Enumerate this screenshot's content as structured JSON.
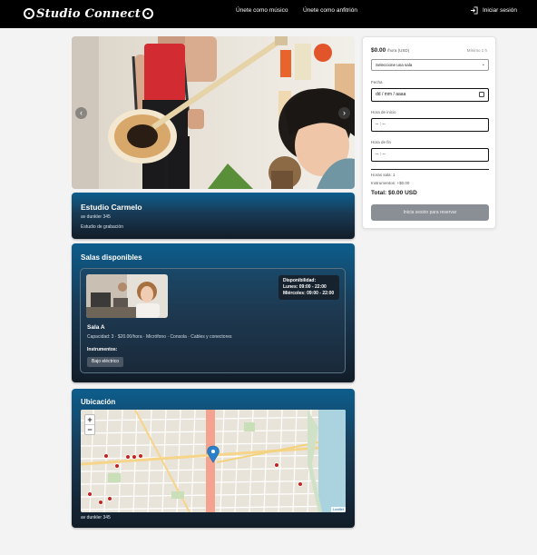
{
  "header": {
    "logo_text": "Studio Connect",
    "nav": [
      "Únete como músico",
      "Únete como anfitrión"
    ],
    "login_label": "Iniciar sesión"
  },
  "carousel": {
    "prev_icon": "chevron-left-icon",
    "next_icon": "chevron-right-icon"
  },
  "studio": {
    "name": "Estudio Carmelo",
    "address": "av dunkler 345",
    "type": "Estudio de grabación"
  },
  "salas": {
    "title": "Salas disponibles",
    "room": {
      "availability_title": "Disponibilidad:",
      "availability": [
        "Lunes: 09:00 - 22:00",
        "Miércoles: 09:00 - 22:00"
      ],
      "name": "Sala A",
      "capacity": "Capacidad: 3 · $20.00/hora · Micrófono · Consola · Cables y conectores",
      "instruments_title": "Instrumentos:",
      "instruments": [
        "Bajo eléctrico"
      ]
    }
  },
  "ubicacion": {
    "title": "Ubicación",
    "zoom_in": "+",
    "zoom_out": "−",
    "attribution": "Leaflet",
    "address": "av dunkler 345"
  },
  "booking": {
    "price": "$0.00",
    "price_unit": "/hora (USD)",
    "min": "Mínimo 1 h",
    "select_placeholder": "Seleccione una sala",
    "date_label": "Fecha",
    "date_value": "dd / mm / aaaa",
    "start_label": "Hora de inicio",
    "start_value": "-- : --",
    "end_label": "Hora de fin",
    "end_value": "-- : --",
    "hours_line": "Horas sala: 1",
    "instruments_line": "Instrumentos: +$0.00",
    "total": "Total: $0.00 USD",
    "reserve_label": "Inicia sesión para reservar"
  },
  "colors": {
    "header": "#000000",
    "card_top": "#0d5e8d",
    "card_bottom": "#121c28",
    "button_disabled": "#8a8f96"
  }
}
